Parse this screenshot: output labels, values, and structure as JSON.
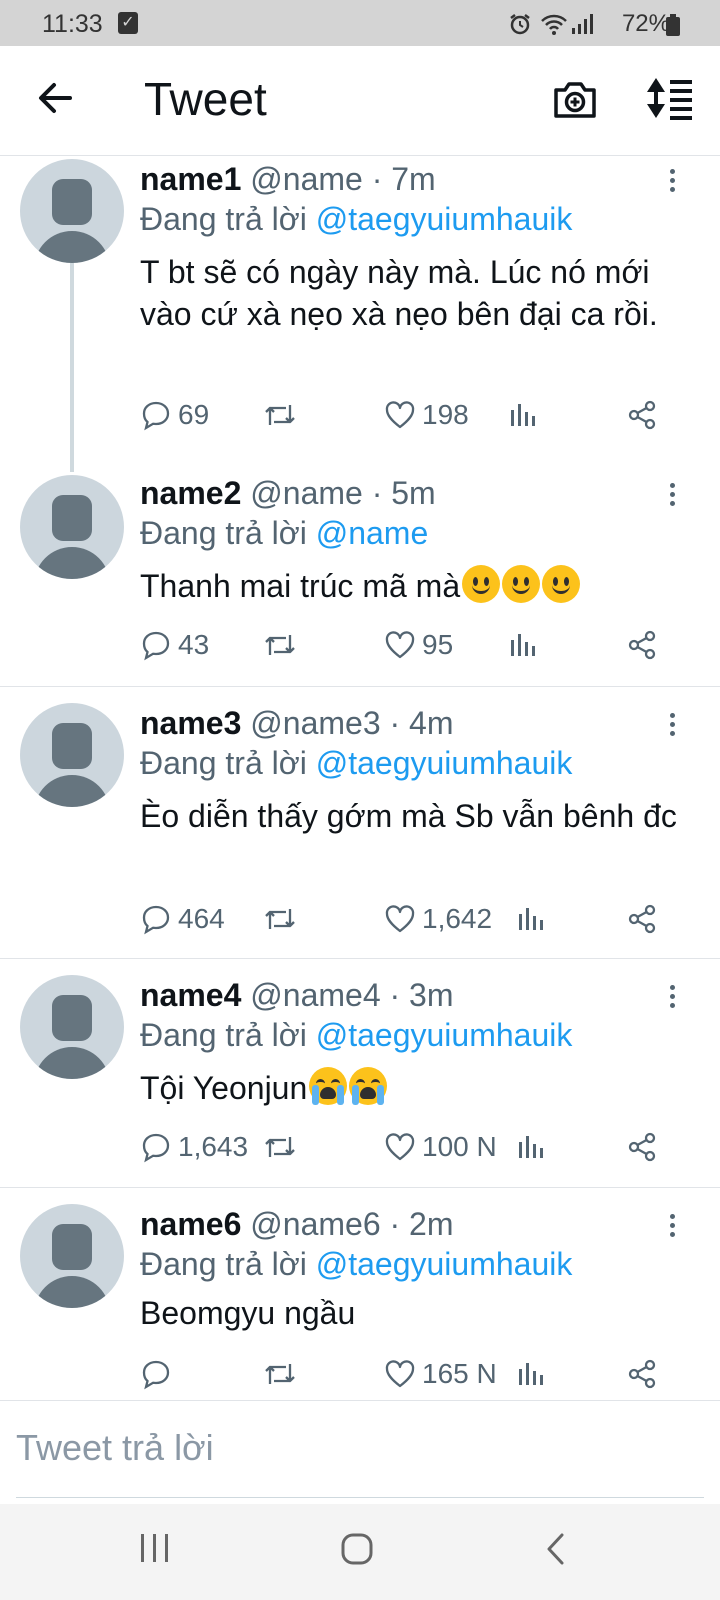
{
  "status_bar": {
    "time": "11:33",
    "battery": "72%"
  },
  "header": {
    "title": "Tweet"
  },
  "tweets": [
    {
      "name": "name1",
      "handle": "@name",
      "time": "· 7m",
      "reply_prefix": "Đang trả lời",
      "reply_to": "@taegyuiumhauik",
      "text": "T bt sẽ có ngày này mà. Lúc nó mới vào cứ xà nẹo xà nẹo bên đại ca rồi.",
      "replies": "69",
      "retweets": "",
      "likes": "198"
    },
    {
      "name": "name2",
      "handle": "@name",
      "time": "· 5m",
      "reply_prefix": "Đang trả lời",
      "reply_to": "@name",
      "text": "Thanh mai trúc mã mà",
      "replies": "43",
      "retweets": "",
      "likes": "95"
    },
    {
      "name": "name3",
      "handle": "@name3",
      "time": "· 4m",
      "reply_prefix": "Đang trả lời",
      "reply_to": "@taegyuiumhauik",
      "text": "Èo diễn thấy gớm mà Sb vẫn bênh đc",
      "replies": "464",
      "retweets": "",
      "likes": "1,642"
    },
    {
      "name": "name4",
      "handle": "@name4",
      "time": "· 3m",
      "reply_prefix": "Đang trả lời",
      "reply_to": "@taegyuiumhauik",
      "text": "Tội Yeonjun",
      "replies": "1,643",
      "retweets": "",
      "likes": "100 N"
    },
    {
      "name": "name6",
      "handle": "@name6",
      "time": "· 2m",
      "reply_prefix": "Đang trả lời",
      "reply_to": "@taegyuiumhauik",
      "text": "Beomgyu ngầu",
      "replies": "",
      "retweets": "",
      "likes": "165 N"
    }
  ],
  "composer": {
    "placeholder": "Tweet trả lời"
  },
  "icons": {
    "back": "arrow-left-icon",
    "camera": "camera-plus-icon",
    "sort": "sort-icon",
    "reply": "comment-icon",
    "retweet": "retweet-icon",
    "like": "heart-icon",
    "analytics": "bar-chart-icon",
    "share": "share-icon",
    "more": "more-vertical-icon",
    "emoji_tweet2": "slightly-smiling-face-emoji",
    "emoji_tweet4": "loudly-crying-face-emoji"
  },
  "colors": {
    "accent": "#1d9bf0",
    "muted": "#536471",
    "avatar_bg": "#ccd6dd",
    "status_bar": "#d4d4d4"
  }
}
